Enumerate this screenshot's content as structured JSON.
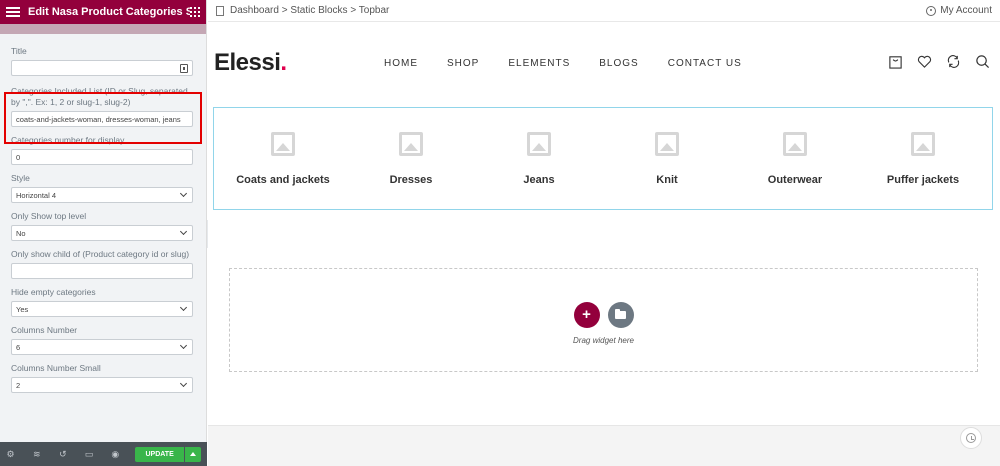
{
  "panel": {
    "title": "Edit Nasa Product Categories SC",
    "fields": {
      "title": {
        "label": "Title",
        "value": ""
      },
      "categories_included": {
        "label": "Categories Included List (ID or Slug, separated by \",\". Ex: 1, 2 or slug-1, slug-2)",
        "value": "coats-and-jackets-woman, dresses-woman, jeans"
      },
      "categories_number": {
        "label": "Categories number for display",
        "value": "0"
      },
      "style": {
        "label": "Style",
        "value": "Horizontal 4"
      },
      "only_top_level": {
        "label": "Only Show top level",
        "value": "No"
      },
      "only_child_of": {
        "label": "Only show child of (Product category id or slug)",
        "value": ""
      },
      "hide_empty": {
        "label": "Hide empty categories",
        "value": "Yes"
      },
      "columns_number": {
        "label": "Columns Number",
        "value": "6"
      },
      "columns_number_small": {
        "label": "Columns Number Small",
        "value": "2"
      }
    },
    "footer": {
      "update_label": "UPDATE"
    }
  },
  "preview": {
    "breadcrumb": "Dashboard > Static Blocks > Topbar",
    "account_label": "My Account",
    "logo": {
      "text": "Elessi",
      "dot": "."
    },
    "nav": [
      "HOME",
      "SHOP",
      "ELEMENTS",
      "BLOGS",
      "CONTACT US"
    ],
    "categories": [
      "Coats and jackets",
      "Dresses",
      "Jeans",
      "Knit",
      "Outerwear",
      "Puffer jackets"
    ],
    "drop_text": "Drag widget here"
  },
  "colors": {
    "accent": "#93003c",
    "logo_dot": "#e0004d",
    "update_green": "#39b54a",
    "highlight_red": "#e30000"
  }
}
